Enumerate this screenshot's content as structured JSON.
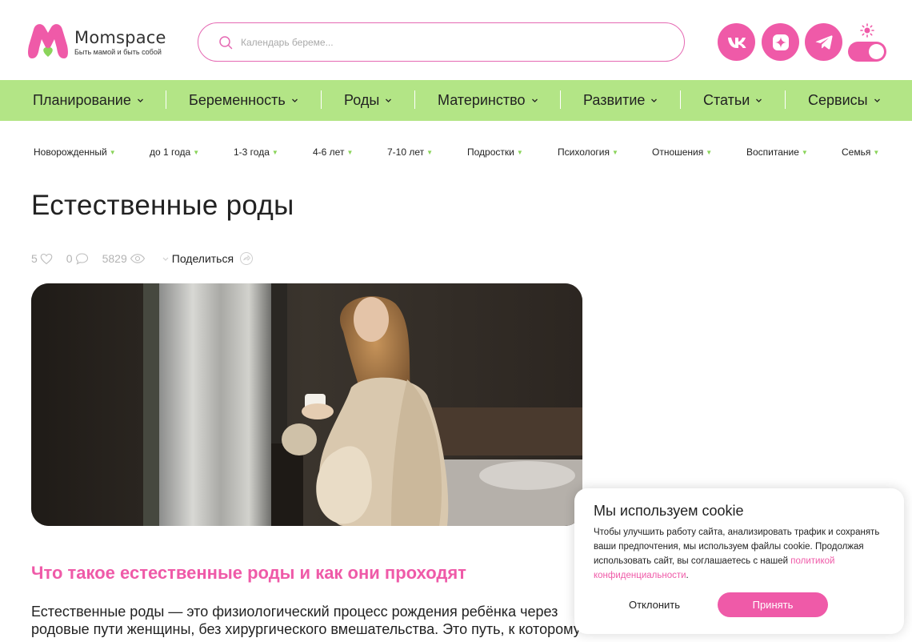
{
  "brand": {
    "name": "Momspace",
    "tagline": "Быть мамой и быть собой"
  },
  "search": {
    "placeholder": "Календарь береме..."
  },
  "social": [
    "vk-icon",
    "max-icon",
    "telegram-icon"
  ],
  "main_nav": [
    "Планирование",
    "Беременность",
    "Роды",
    "Материнство",
    "Развитие",
    "Статьи",
    "Сервисы"
  ],
  "sub_nav": [
    "Новорожденный",
    "до 1 года",
    "1-3 года",
    "4-6 лет",
    "7-10 лет",
    "Подростки",
    "Психология",
    "Отношения",
    "Воспитание",
    "Семья"
  ],
  "article": {
    "title": "Естественные роды",
    "likes": "5",
    "comments": "0",
    "views": "5829",
    "share_label": "Поделиться",
    "subtitle": "Что такое естественные роды и как они проходят",
    "body": "Естественные роды — это физиологический процесс рождения ребёнка через родовые пути женщины, без хирургического вмешательства. Это путь, к которому"
  },
  "cookie": {
    "title": "Мы используем cookie",
    "text": "Чтобы улучшить работу сайта, анализировать трафик и сохранять ваши предпочтения, мы используем файлы cookie. Продолжая использовать сайт, вы соглашаетесь с нашей ",
    "link": "политикой конфиденциальности",
    "text_end": ".",
    "decline": "Отклонить",
    "accept": "Принять"
  },
  "colors": {
    "accent": "#ef5aa8",
    "nav_bg": "#b3e586",
    "dot": "#8ad45a"
  }
}
